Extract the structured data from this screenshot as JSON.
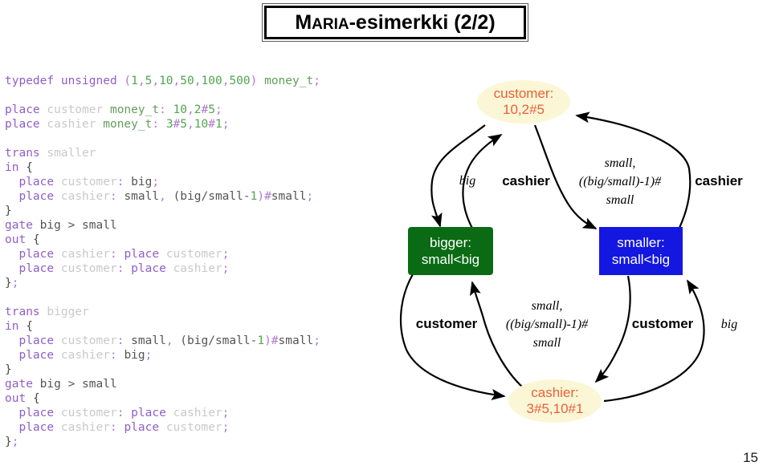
{
  "slide": {
    "title": "MARIA-esimerkki (2/2)",
    "title_first_letter": "M",
    "title_smallcaps": "ARIA",
    "title_rest": "-esimerkki (2/2)",
    "page_number": "15"
  },
  "code": {
    "blocks": [
      {
        "id": "typedef-block",
        "lines": [
          [
            {
              "t": "typedef unsigned ",
              "c": "kw"
            },
            {
              "t": "(",
              "c": "pn"
            },
            {
              "t": "1",
              "c": "num"
            },
            {
              "t": ",",
              "c": "pn"
            },
            {
              "t": "5",
              "c": "num"
            },
            {
              "t": ",",
              "c": "pn"
            },
            {
              "t": "10",
              "c": "num"
            },
            {
              "t": ",",
              "c": "pn"
            },
            {
              "t": "50",
              "c": "num"
            },
            {
              "t": ",",
              "c": "pn"
            },
            {
              "t": "100",
              "c": "num"
            },
            {
              "t": ",",
              "c": "pn"
            },
            {
              "t": "500",
              "c": "num"
            },
            {
              "t": ")",
              "c": "pn"
            },
            {
              "t": " ",
              "c": "pl"
            },
            {
              "t": "money_t",
              "c": "ty"
            },
            {
              "t": ";",
              "c": "pn"
            }
          ]
        ]
      },
      {
        "id": "place-declarations",
        "lines": [
          [
            {
              "t": "place",
              "c": "kw"
            },
            {
              "t": " ",
              "c": "pl"
            },
            {
              "t": "customer",
              "c": "id"
            },
            {
              "t": " ",
              "c": "pl"
            },
            {
              "t": "money_t",
              "c": "ty"
            },
            {
              "t": ": ",
              "c": "pn"
            },
            {
              "t": "10",
              "c": "num"
            },
            {
              "t": ",",
              "c": "pn"
            },
            {
              "t": "2",
              "c": "num"
            },
            {
              "t": "#",
              "c": "pn"
            },
            {
              "t": "5",
              "c": "num"
            },
            {
              "t": ";",
              "c": "pn"
            }
          ],
          [
            {
              "t": "place",
              "c": "kw"
            },
            {
              "t": " ",
              "c": "pl"
            },
            {
              "t": "cashier",
              "c": "id"
            },
            {
              "t": " ",
              "c": "pl"
            },
            {
              "t": "money_t",
              "c": "ty"
            },
            {
              "t": ": ",
              "c": "pn"
            },
            {
              "t": "3",
              "c": "num"
            },
            {
              "t": "#",
              "c": "pn"
            },
            {
              "t": "5",
              "c": "num"
            },
            {
              "t": ",",
              "c": "pn"
            },
            {
              "t": "10",
              "c": "num"
            },
            {
              "t": "#",
              "c": "pn"
            },
            {
              "t": "1",
              "c": "num"
            },
            {
              "t": ";",
              "c": "pn"
            }
          ]
        ]
      },
      {
        "id": "trans-smaller",
        "lines": [
          [
            {
              "t": "trans",
              "c": "kw"
            },
            {
              "t": " ",
              "c": "pl"
            },
            {
              "t": "smaller",
              "c": "id"
            }
          ],
          [
            {
              "t": "in",
              "c": "kw"
            },
            {
              "t": " ",
              "c": "pl"
            },
            {
              "t": "{",
              "c": "br"
            }
          ],
          [
            {
              "t": "  ",
              "c": "pl"
            },
            {
              "t": "place",
              "c": "kw"
            },
            {
              "t": " ",
              "c": "pl"
            },
            {
              "t": "customer",
              "c": "id"
            },
            {
              "t": ": ",
              "c": "pn"
            },
            {
              "t": "big",
              "c": "pl"
            },
            {
              "t": ";",
              "c": "pn"
            }
          ],
          [
            {
              "t": "  ",
              "c": "pl"
            },
            {
              "t": "place",
              "c": "kw"
            },
            {
              "t": " ",
              "c": "pl"
            },
            {
              "t": "cashier",
              "c": "id"
            },
            {
              "t": ": ",
              "c": "pn"
            },
            {
              "t": "small",
              "c": "pl"
            },
            {
              "t": ", ",
              "c": "pn"
            },
            {
              "t": "(big/small-",
              "c": "pl"
            },
            {
              "t": "1",
              "c": "num"
            },
            {
              "t": ")",
              "c": "pn"
            },
            {
              "t": "#",
              "c": "pn"
            },
            {
              "t": "small",
              "c": "pl"
            },
            {
              "t": ";",
              "c": "pn"
            }
          ],
          [
            {
              "t": "}",
              "c": "br"
            }
          ],
          [
            {
              "t": "gate",
              "c": "kw"
            },
            {
              "t": " big > small",
              "c": "pl"
            }
          ],
          [
            {
              "t": "out",
              "c": "kw"
            },
            {
              "t": " ",
              "c": "pl"
            },
            {
              "t": "{",
              "c": "br"
            }
          ],
          [
            {
              "t": "  ",
              "c": "pl"
            },
            {
              "t": "place",
              "c": "kw"
            },
            {
              "t": " ",
              "c": "pl"
            },
            {
              "t": "cashier",
              "c": "id"
            },
            {
              "t": ": ",
              "c": "pn"
            },
            {
              "t": "place",
              "c": "kw"
            },
            {
              "t": " ",
              "c": "pl"
            },
            {
              "t": "customer",
              "c": "id"
            },
            {
              "t": ";",
              "c": "pn"
            }
          ],
          [
            {
              "t": "  ",
              "c": "pl"
            },
            {
              "t": "place",
              "c": "kw"
            },
            {
              "t": " ",
              "c": "pl"
            },
            {
              "t": "customer",
              "c": "id"
            },
            {
              "t": ": ",
              "c": "pn"
            },
            {
              "t": "place",
              "c": "kw"
            },
            {
              "t": " ",
              "c": "pl"
            },
            {
              "t": "cashier",
              "c": "id"
            },
            {
              "t": ";",
              "c": "pn"
            }
          ],
          [
            {
              "t": "}",
              "c": "br"
            },
            {
              "t": ";",
              "c": "pn"
            }
          ]
        ]
      },
      {
        "id": "trans-bigger",
        "lines": [
          [
            {
              "t": "trans",
              "c": "kw"
            },
            {
              "t": " ",
              "c": "pl"
            },
            {
              "t": "bigger",
              "c": "id"
            }
          ],
          [
            {
              "t": "in",
              "c": "kw"
            },
            {
              "t": " ",
              "c": "pl"
            },
            {
              "t": "{",
              "c": "br"
            }
          ],
          [
            {
              "t": "  ",
              "c": "pl"
            },
            {
              "t": "place",
              "c": "kw"
            },
            {
              "t": " ",
              "c": "pl"
            },
            {
              "t": "customer",
              "c": "id"
            },
            {
              "t": ": ",
              "c": "pn"
            },
            {
              "t": "small",
              "c": "pl"
            },
            {
              "t": ", ",
              "c": "pn"
            },
            {
              "t": "(big/small-",
              "c": "pl"
            },
            {
              "t": "1",
              "c": "num"
            },
            {
              "t": ")",
              "c": "pn"
            },
            {
              "t": "#",
              "c": "pn"
            },
            {
              "t": "small",
              "c": "pl"
            },
            {
              "t": ";",
              "c": "pn"
            }
          ],
          [
            {
              "t": "  ",
              "c": "pl"
            },
            {
              "t": "place",
              "c": "kw"
            },
            {
              "t": " ",
              "c": "pl"
            },
            {
              "t": "cashier",
              "c": "id"
            },
            {
              "t": ": ",
              "c": "pn"
            },
            {
              "t": "big",
              "c": "pl"
            },
            {
              "t": ";",
              "c": "pn"
            }
          ],
          [
            {
              "t": "}",
              "c": "br"
            }
          ],
          [
            {
              "t": "gate",
              "c": "kw"
            },
            {
              "t": " big > small",
              "c": "pl"
            }
          ],
          [
            {
              "t": "out",
              "c": "kw"
            },
            {
              "t": " ",
              "c": "pl"
            },
            {
              "t": "{",
              "c": "br"
            }
          ],
          [
            {
              "t": "  ",
              "c": "pl"
            },
            {
              "t": "place",
              "c": "kw"
            },
            {
              "t": " ",
              "c": "pl"
            },
            {
              "t": "customer",
              "c": "id"
            },
            {
              "t": ": ",
              "c": "pn"
            },
            {
              "t": "place",
              "c": "kw"
            },
            {
              "t": " ",
              "c": "pl"
            },
            {
              "t": "cashier",
              "c": "id"
            },
            {
              "t": ";",
              "c": "pn"
            }
          ],
          [
            {
              "t": "  ",
              "c": "pl"
            },
            {
              "t": "place",
              "c": "kw"
            },
            {
              "t": " ",
              "c": "pl"
            },
            {
              "t": "cashier",
              "c": "id"
            },
            {
              "t": ": ",
              "c": "pn"
            },
            {
              "t": "place",
              "c": "kw"
            },
            {
              "t": " ",
              "c": "pl"
            },
            {
              "t": "customer",
              "c": "id"
            },
            {
              "t": ";",
              "c": "pn"
            }
          ],
          [
            {
              "t": "}",
              "c": "br"
            },
            {
              "t": ";",
              "c": "pn"
            }
          ]
        ]
      }
    ]
  },
  "diagram": {
    "colors": {
      "place_fill": "#fbf6d5",
      "place_text": "#e8603c",
      "bigger_fill": "#0a6b14",
      "smaller_fill": "#1417e0",
      "transition_text": "#ffffff",
      "edge_stroke": "#000000"
    },
    "nodes": {
      "customer_place": {
        "line1": "customer:",
        "line2": "10,2#5"
      },
      "cashier_place": {
        "line1": "cashier:",
        "line2": "3#5,10#1"
      },
      "bigger_transition": {
        "line1": "bigger:",
        "line2": "small<big"
      },
      "smaller_transition": {
        "line1": "smaller:",
        "line2": "small<big"
      }
    },
    "edge_labels": {
      "customer_to_bigger": "big",
      "bigger_to_customer": "cashier",
      "customer_to_smaller_l1": "small,",
      "customer_to_smaller_l2": "((big/small)-1)#",
      "customer_to_smaller_l3": "small",
      "smaller_to_customer": "cashier",
      "bigger_to_cashier": "customer",
      "cashier_to_bigger_l1": "small,",
      "cashier_to_bigger_l2": "((big/small)-1)#",
      "cashier_to_bigger_l3": "small",
      "smaller_to_cashier": "customer",
      "cashier_to_smaller": "big"
    }
  }
}
